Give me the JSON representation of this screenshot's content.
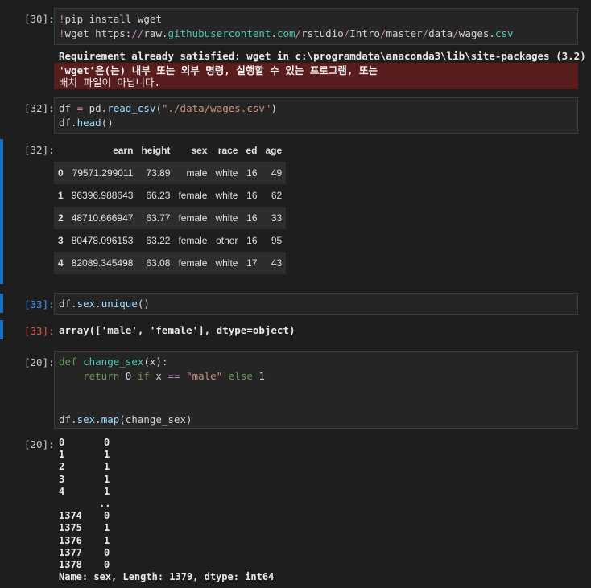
{
  "cells": [
    {
      "prompt": "[30]:",
      "code": [
        "!pip install wget",
        "!wget https://raw.githubusercontent.com/rstudio/Intro/master/data/wages.csv"
      ],
      "output_line": "Requirement already satisfied: wget in c:\\programdata\\anaconda3\\lib\\site-packages (3.2)",
      "error_line1": "'wget'은(는) 내부 또는 외부 명령, 실행할 수 있는 프로그램, 또는",
      "error_line2": "배치 파일이 아닙니다."
    },
    {
      "prompt": "[32]:",
      "code": [
        "df = pd.read_csv(\"./data/wages.csv\")",
        "df.head()"
      ],
      "out_prompt": "[32]:"
    },
    {
      "prompt": "[33]:",
      "code": [
        "df.sex.unique()"
      ],
      "out_prompt": "[33]:",
      "output": "array(['male', 'female'], dtype=object)"
    },
    {
      "prompt": "[20]:",
      "code_line1_kw": "def",
      "code_line1_fn": "change_sex",
      "code_line1_rest": "(x):",
      "code_line2_ret": "return",
      "code_line2_rest_a": " 0 ",
      "code_line2_if": "if",
      "code_line2_rest_b": " x ",
      "code_line2_eq": "==",
      "code_line2_str": "\"male\"",
      "code_line2_else": "else",
      "code_line2_end": " 1",
      "code_line5": "df.sex.map(change_sex)",
      "out_prompt": "[20]:"
    }
  ],
  "dataframe": {
    "columns": [
      "",
      "earn",
      "height",
      "sex",
      "race",
      "ed",
      "age"
    ],
    "rows": [
      [
        "0",
        "79571.299011",
        "73.89",
        "male",
        "white",
        "16",
        "49"
      ],
      [
        "1",
        "96396.988643",
        "66.23",
        "female",
        "white",
        "16",
        "62"
      ],
      [
        "2",
        "48710.666947",
        "63.77",
        "female",
        "white",
        "16",
        "33"
      ],
      [
        "3",
        "80478.096153",
        "63.22",
        "female",
        "other",
        "16",
        "95"
      ],
      [
        "4",
        "82089.345498",
        "63.08",
        "female",
        "white",
        "17",
        "43"
      ]
    ]
  },
  "series_output": {
    "lines": [
      [
        "0",
        "0"
      ],
      [
        "1",
        "1"
      ],
      [
        "2",
        "1"
      ],
      [
        "3",
        "1"
      ],
      [
        "4",
        "1"
      ],
      [
        "",
        ".."
      ],
      [
        "1374",
        "0"
      ],
      [
        "1375",
        "1"
      ],
      [
        "1376",
        "1"
      ],
      [
        "1377",
        "0"
      ],
      [
        "1378",
        "0"
      ]
    ],
    "footer": "Name: sex, Length: 1379, dtype: int64"
  },
  "colors": {
    "background": "#1e1e1e",
    "cell_background": "#252526",
    "error_background": "#5a1d1d",
    "active_bar": "#1f6fbf"
  }
}
